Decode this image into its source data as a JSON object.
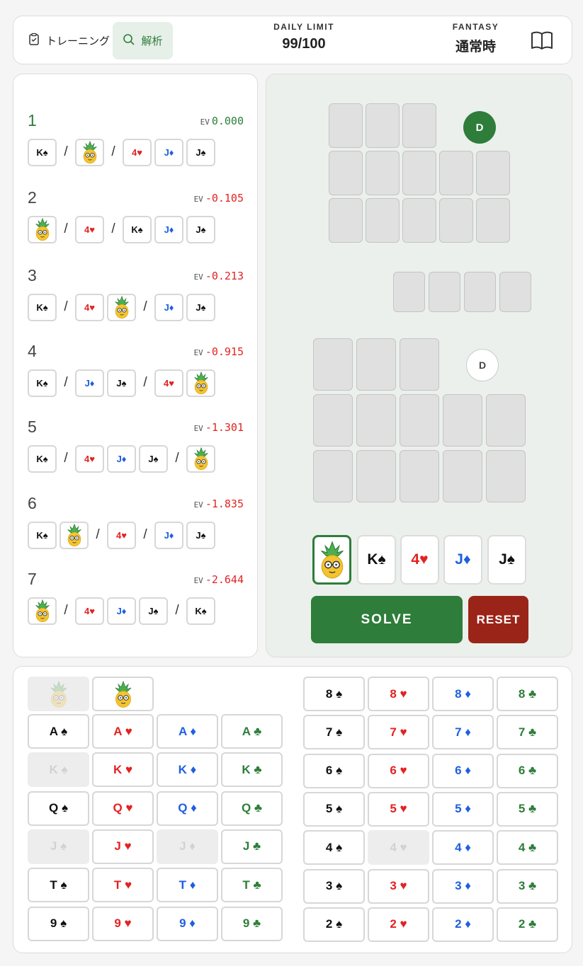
{
  "header": {
    "training_label": "トレーニング",
    "analysis_label": "解析",
    "limit_label": "DAILY LIMIT",
    "limit_value": "99/100",
    "fantasy_label": "FANTASY",
    "fantasy_value": "通常時"
  },
  "results": {
    "ev_label": "EV",
    "solutions": [
      {
        "rank": "1",
        "ev": "0.000",
        "cards": [
          {
            "t": "K♠",
            "c": "black"
          },
          {
            "t": "/",
            "sep": true
          },
          {
            "joker": true
          },
          {
            "t": "/",
            "sep": true
          },
          {
            "t": "4♥",
            "c": "red"
          },
          {
            "t": "J♦",
            "c": "blue"
          },
          {
            "t": "J♠",
            "c": "black"
          }
        ]
      },
      {
        "rank": "2",
        "ev": "-0.105",
        "cards": [
          {
            "joker": true
          },
          {
            "t": "/",
            "sep": true
          },
          {
            "t": "4♥",
            "c": "red"
          },
          {
            "t": "/",
            "sep": true
          },
          {
            "t": "K♠",
            "c": "black"
          },
          {
            "t": "J♦",
            "c": "blue"
          },
          {
            "t": "J♠",
            "c": "black"
          }
        ]
      },
      {
        "rank": "3",
        "ev": "-0.213",
        "cards": [
          {
            "t": "K♠",
            "c": "black"
          },
          {
            "t": "/",
            "sep": true
          },
          {
            "t": "4♥",
            "c": "red"
          },
          {
            "joker": true
          },
          {
            "t": "/",
            "sep": true
          },
          {
            "t": "J♦",
            "c": "blue"
          },
          {
            "t": "J♠",
            "c": "black"
          }
        ]
      },
      {
        "rank": "4",
        "ev": "-0.915",
        "cards": [
          {
            "t": "K♠",
            "c": "black"
          },
          {
            "t": "/",
            "sep": true
          },
          {
            "t": "J♦",
            "c": "blue"
          },
          {
            "t": "J♠",
            "c": "black"
          },
          {
            "t": "/",
            "sep": true
          },
          {
            "t": "4♥",
            "c": "red"
          },
          {
            "joker": true
          }
        ]
      },
      {
        "rank": "5",
        "ev": "-1.301",
        "cards": [
          {
            "t": "K♠",
            "c": "black"
          },
          {
            "t": "/",
            "sep": true
          },
          {
            "t": "4♥",
            "c": "red"
          },
          {
            "t": "J♦",
            "c": "blue"
          },
          {
            "t": "J♠",
            "c": "black"
          },
          {
            "t": "/",
            "sep": true
          },
          {
            "joker": true
          }
        ]
      },
      {
        "rank": "6",
        "ev": "-1.835",
        "cards": [
          {
            "t": "K♠",
            "c": "black"
          },
          {
            "joker": true
          },
          {
            "t": "/",
            "sep": true
          },
          {
            "t": "4♥",
            "c": "red"
          },
          {
            "t": "/",
            "sep": true
          },
          {
            "t": "J♦",
            "c": "blue"
          },
          {
            "t": "J♠",
            "c": "black"
          }
        ]
      },
      {
        "rank": "7",
        "ev": "-2.644",
        "cards": [
          {
            "joker": true
          },
          {
            "t": "/",
            "sep": true
          },
          {
            "t": "4♥",
            "c": "red"
          },
          {
            "t": "J♦",
            "c": "blue"
          },
          {
            "t": "J♠",
            "c": "black"
          },
          {
            "t": "/",
            "sep": true
          },
          {
            "t": "K♠",
            "c": "black"
          }
        ]
      }
    ]
  },
  "board": {
    "dealer_label": "D",
    "hand": [
      {
        "joker": true,
        "selected": true
      },
      {
        "t": "K♠",
        "c": "black"
      },
      {
        "t": "4♥",
        "c": "red"
      },
      {
        "t": "J♦",
        "c": "blue"
      },
      {
        "t": "J♠",
        "c": "black"
      }
    ],
    "solve_label": "SOLVE",
    "reset_label": "RESET"
  },
  "deck": {
    "jokers": [
      {
        "used": true
      },
      {
        "used": false
      }
    ],
    "left_ranks": [
      "A",
      "K",
      "Q",
      "J",
      "T",
      "9"
    ],
    "right_ranks": [
      "8",
      "7",
      "6",
      "5",
      "4",
      "3",
      "2"
    ],
    "suits": [
      {
        "sym": "♠",
        "color": "black"
      },
      {
        "sym": "♥",
        "color": "red"
      },
      {
        "sym": "♦",
        "color": "blue"
      },
      {
        "sym": "♣",
        "color": "green"
      }
    ],
    "used_cards": [
      "K♠",
      "J♠",
      "J♦",
      "4♥"
    ]
  },
  "colors": {
    "accent_green": "#2e7d3a",
    "reset_red": "#9b2418",
    "hearts": "#e32222",
    "diamonds": "#1f5fe0",
    "clubs": "#2e7d3a",
    "spades": "#111111"
  }
}
